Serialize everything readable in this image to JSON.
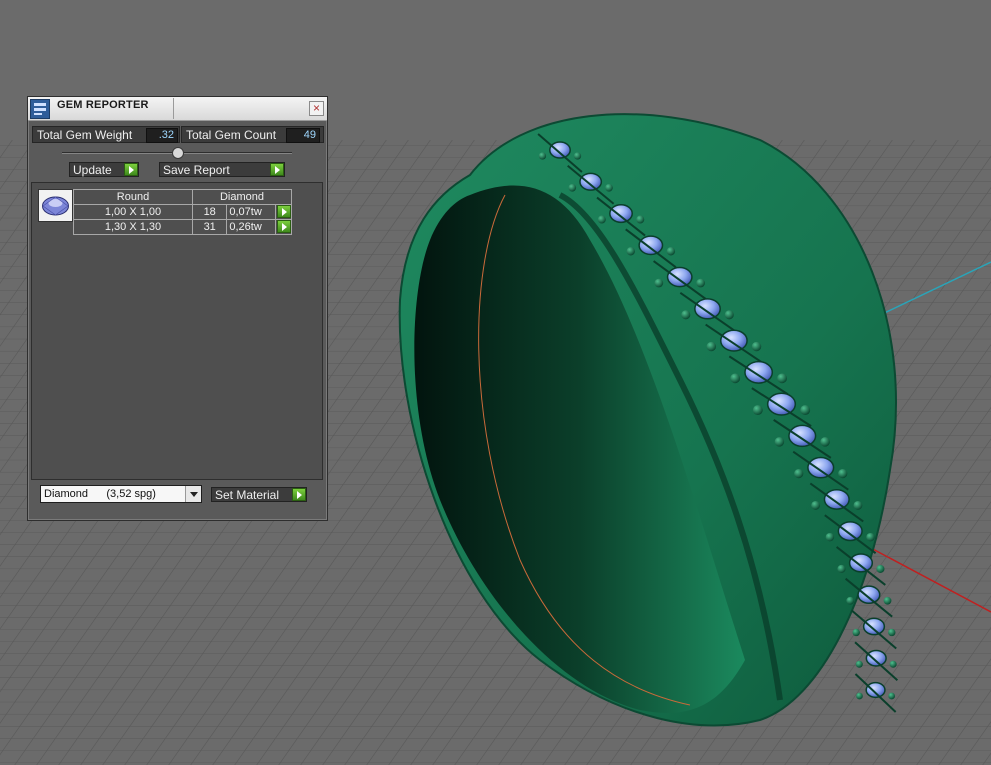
{
  "panel": {
    "title": "GEM REPORTER",
    "close_icon": "×",
    "total_weight_label": "Total Gem Weight",
    "total_weight_value": ".32",
    "total_count_label": "Total Gem Count",
    "total_count_value": "49",
    "update_label": "Update",
    "save_report_label": "Save Report",
    "table": {
      "header": [
        "Round",
        "Diamond"
      ],
      "rows": [
        {
          "size": "1,00 X 1,00",
          "count": "18",
          "weight": "0,07tw"
        },
        {
          "size": "1,30 X 1,30",
          "count": "31",
          "weight": "0,26tw"
        }
      ]
    },
    "material_selected": "Diamond      (3,52 spg)",
    "set_material_label": "Set Material"
  },
  "colors": {
    "ring": "#1e7a56",
    "gem": "#8ea8f0",
    "grid_bg": "#6b6b6b",
    "axis_x": "#c02020",
    "axis_y": "#2aa4b8"
  }
}
